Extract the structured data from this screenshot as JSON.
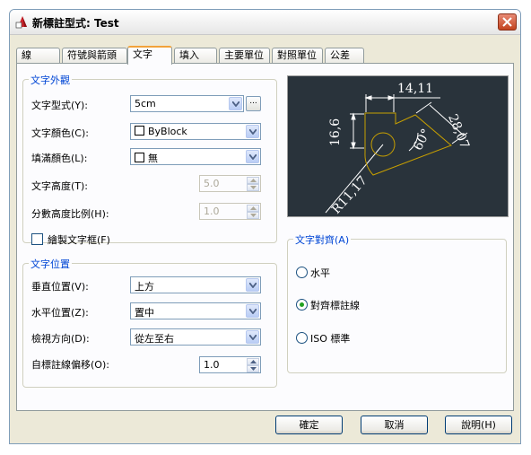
{
  "window": {
    "title": "新標註型式: Test"
  },
  "tabs": [
    {
      "label": "線"
    },
    {
      "label": "符號與箭頭"
    },
    {
      "label": "文字"
    },
    {
      "label": "填入"
    },
    {
      "label": "主要單位"
    },
    {
      "label": "對照單位"
    },
    {
      "label": "公差"
    }
  ],
  "active_tab": "文字",
  "appearance": {
    "title": "文字外觀",
    "style_label": "文字型式(Y):",
    "style_value": "5cm",
    "style_browse": "...",
    "color_label": "文字顏色(C):",
    "color_value": "ByBlock",
    "fill_label": "填滿顏色(L):",
    "fill_value": "無",
    "height_label": "文字高度(T):",
    "height_value": "5.0",
    "fraction_label": "分數高度比例(H):",
    "fraction_value": "1.0",
    "frame_label": "繪製文字框(F)"
  },
  "placement": {
    "title": "文字位置",
    "vertical_label": "垂直位置(V):",
    "vertical_value": "上方",
    "horizontal_label": "水平位置(Z):",
    "horizontal_value": "置中",
    "view_label": "檢視方向(D):",
    "view_value": "從左至右",
    "offset_label": "自標註線偏移(O):",
    "offset_value": "1.0"
  },
  "preview": {
    "dim_top": "14,11",
    "dim_left": "16,6",
    "dim_right": "28,07",
    "dim_angle": "60°",
    "dim_radius": "R11,17"
  },
  "alignment": {
    "title": "文字對齊(A)",
    "options": [
      {
        "label": "水平",
        "selected": false
      },
      {
        "label": "對齊標註線",
        "selected": true
      },
      {
        "label": "ISO 標準",
        "selected": false
      }
    ]
  },
  "buttons": {
    "ok": "確定",
    "cancel": "取消",
    "help": "說明(H)"
  },
  "colors": {
    "preview_bg": "#29333b",
    "shape": "#c8a000",
    "accent": "#f2a23a",
    "group_title": "#0046d5"
  }
}
